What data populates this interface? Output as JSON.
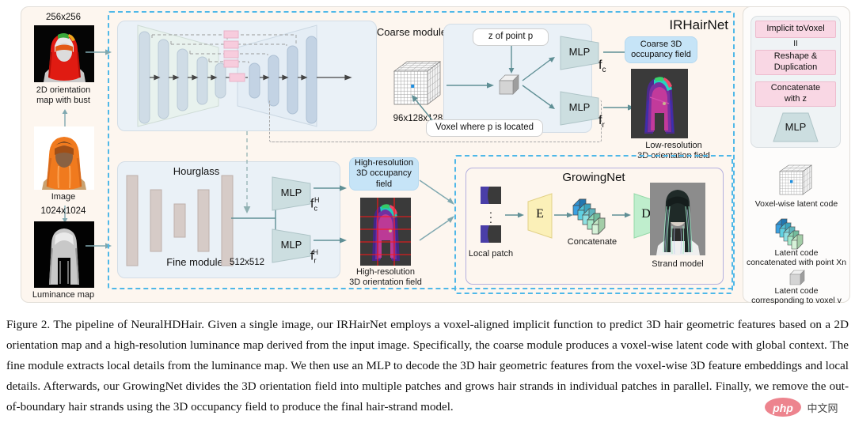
{
  "figure": {
    "title": "IRHairNet",
    "growingnet_title": "GrowingNet",
    "coarse_module_title": "Coarse module",
    "hourglass_title": "Hourglass",
    "fine_module_title": "Fine module"
  },
  "inputs": [
    {
      "size_label": "256x256",
      "caption": "2D orientation\nmap with bust",
      "name": "orientation-map-thumbnail"
    },
    {
      "size_label": "",
      "caption": "Image",
      "name": "input-image-thumbnail"
    },
    {
      "size_label": "1024x1024",
      "caption": "Luminance map",
      "name": "luminance-map-thumbnail"
    }
  ],
  "coarse": {
    "voxel_dim": "96x128x128",
    "voxel_callout": "Voxel where p is located",
    "z_callout": "z of point p",
    "mlp_label": "MLP",
    "fc_label": "f",
    "fc_sub": "c",
    "fr_label": "f",
    "fr_sub": "r"
  },
  "coarse_outputs": {
    "occupancy": "Coarse 3D\noccupancy field",
    "orientation_caption": "Low-resolution\n3D orientation field"
  },
  "fine": {
    "dim_label": "512x512",
    "mlp_label": "MLP",
    "fch_base": "f",
    "fch_sub": "c",
    "fch_sup": "H",
    "frh_base": "f",
    "frh_sub": "r",
    "frh_sup": "H"
  },
  "fine_outputs": {
    "occupancy": "High-resolution\n3D occupancy\nfield",
    "orientation_caption": "High-resolution\n3D orientation field"
  },
  "growing": {
    "local_patch": "Local patch",
    "encoder": "E",
    "decoder": "D",
    "concatenate": "Concatenate",
    "strand_model": "Strand model"
  },
  "legend": {
    "box_items": [
      {
        "label": "Implicit toVoxel",
        "type": "pink"
      },
      {
        "label": "II",
        "type": "equals"
      },
      {
        "label": "Reshape &\nDuplication",
        "type": "pink"
      },
      {
        "label": "Concatenate\nwith z",
        "type": "pink"
      },
      {
        "label": "MLP",
        "type": "trapezoid"
      }
    ],
    "symbol_items": [
      {
        "icon": "voxel-grid-icon",
        "label": "Voxel-wise latent code"
      },
      {
        "icon": "latent-code-strip-icon",
        "label": "Latent code\nconcatenated with point Xn"
      },
      {
        "icon": "single-voxel-icon",
        "label": "Latent code\ncorresponding to voxel v"
      }
    ]
  },
  "caption": {
    "text": "Figure 2.  The pipeline of NeuralHDHair.  Given a single image, our IRHairNet employs a voxel-aligned implicit function to predict 3D hair geometric features based on a 2D orientation map and a high-resolution luminance map  derived from the input image. Specifically, the coarse module produces a voxel-wise latent code with global context. The fine module extracts local details from the luminance map. We then use an MLP to decode the 3D hair geometric features from the voxel-wise 3D feature embeddings and local details.  Afterwards, our GrowingNet divides the 3D orientation field into multiple patches and grows hair strands in individual patches in parallel. Finally, we remove the out-of-boundary hair strands using the 3D occupancy field to produce the final hair-strand model."
  },
  "watermark": {
    "brand": "php",
    "site": "中文网"
  },
  "colors": {
    "accent_blue": "#4fb8e8",
    "panel_cream": "#fdf6ef",
    "panel_blue": "#eaf1f7",
    "pink": "#f9d7e4",
    "callout_blue": "#c6e4f7",
    "encoder_yellow": "#fbf0b8",
    "decoder_green": "#bfeecd",
    "arrow": "#5f8f95"
  }
}
